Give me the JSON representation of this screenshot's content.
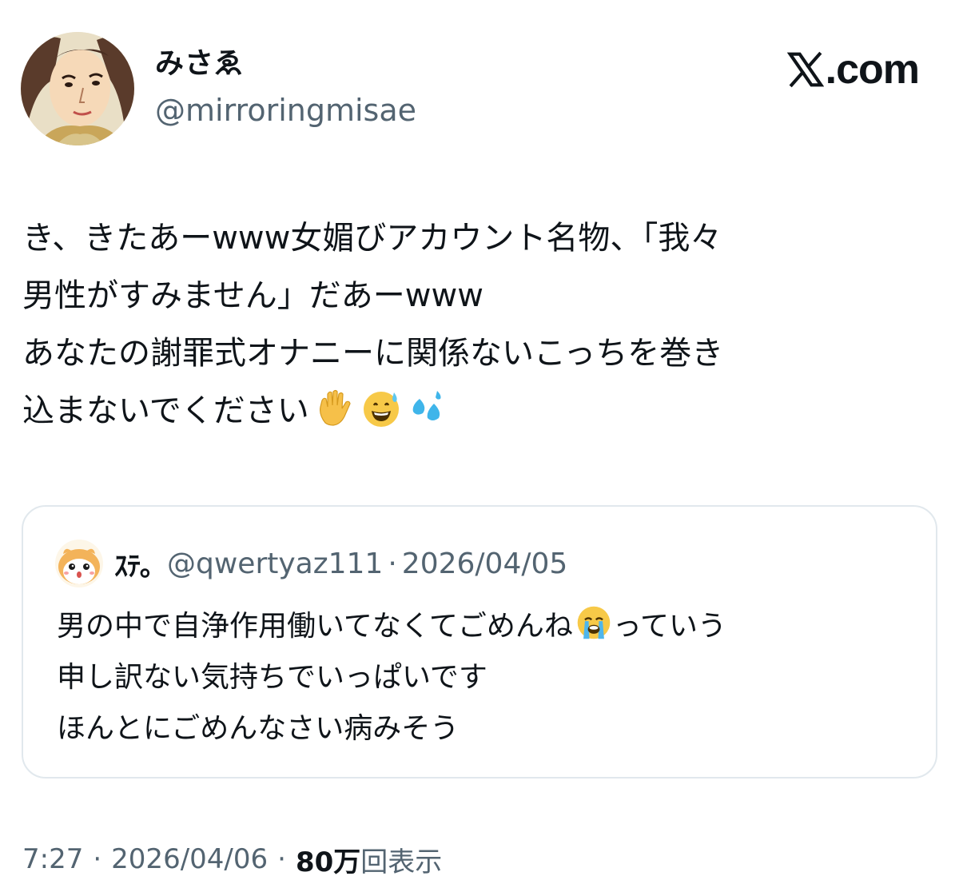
{
  "tweet": {
    "author": {
      "display_name": "みさゑ",
      "handle": "@mirroringmisae",
      "avatar_icon": "user-avatar-cartoon-woman"
    },
    "brand": {
      "icon": "x-logo-icon",
      "text": ".com"
    },
    "text_lines": [
      "き、きたあーwww女媚びアカウント名物、「我々",
      "男性がすみません」だあーwww",
      "あなたの謝罪式オナニーに関係ないこっちを巻き",
      "込まないでください"
    ],
    "emojis": [
      "raised-hand-emoji",
      "sweat-smile-emoji",
      "sweat-droplets-emoji"
    ],
    "quoted": {
      "avatar_icon": "user-avatar-hamster",
      "display_name": "ｽﾃ｡",
      "handle": "@qwertyaz111",
      "separator": "·",
      "date": "2026/04/05",
      "text_lines": [
        "男の中で自浄作用働いてなくてごめんね",
        "申し訳ない気持ちでいっぱいです",
        "ほんとにごめんなさい病みそう"
      ],
      "line1_suffix": "っていう",
      "emoji": "loudly-crying-face-emoji"
    },
    "meta": {
      "time": "7:27",
      "separator": "·",
      "date": "2026/04/06",
      "views_count": "80万",
      "views_label": "回表示"
    }
  }
}
